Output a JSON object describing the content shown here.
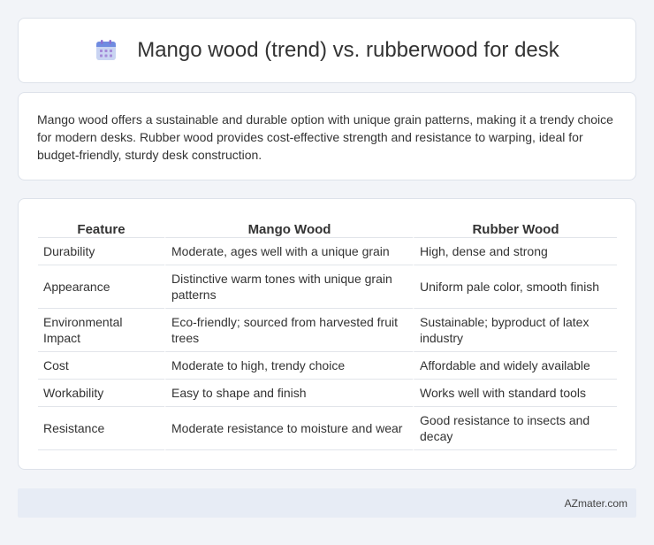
{
  "header": {
    "title": "Mango wood (trend) vs. rubberwood for desk",
    "icon": "calendar-icon"
  },
  "summary": {
    "text": "Mango wood offers a sustainable and durable option with unique grain patterns, making it a trendy choice for modern desks. Rubber wood provides cost-effective strength and resistance to warping, ideal for budget-friendly, sturdy desk construction."
  },
  "table": {
    "headers": [
      "Feature",
      "Mango Wood",
      "Rubber Wood"
    ],
    "rows": [
      [
        "Durability",
        "Moderate, ages well with a unique grain",
        "High, dense and strong"
      ],
      [
        "Appearance",
        "Distinctive warm tones with unique grain patterns",
        "Uniform pale color, smooth finish"
      ],
      [
        "Environmental Impact",
        "Eco-friendly; sourced from harvested fruit trees",
        "Sustainable; byproduct of latex industry"
      ],
      [
        "Cost",
        "Moderate to high, trendy choice",
        "Affordable and widely available"
      ],
      [
        "Workability",
        "Easy to shape and finish",
        "Works well with standard tools"
      ],
      [
        "Resistance",
        "Moderate resistance to moisture and wear",
        "Good resistance to insects and decay"
      ]
    ]
  },
  "footer": {
    "brand": "AZmater.com"
  }
}
